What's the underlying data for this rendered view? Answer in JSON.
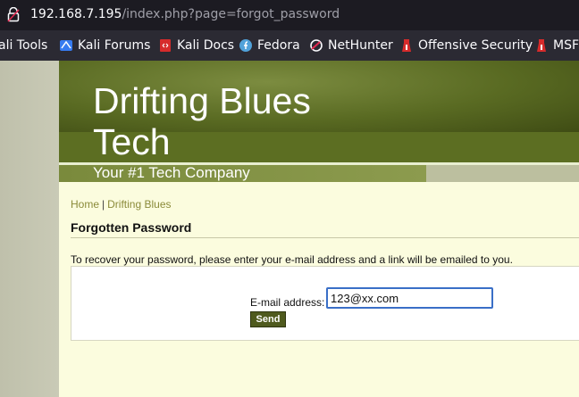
{
  "browser": {
    "url_host": "192.168.7.195",
    "url_path": "/index.php?page=forgot_password",
    "bookmarks": [
      {
        "label": "ali Tools",
        "icon": "kali-icon"
      },
      {
        "label": "Kali Forums",
        "icon": "kali-forums-icon"
      },
      {
        "label": "Kali Docs",
        "icon": "kali-docs-icon"
      },
      {
        "label": "Fedora",
        "icon": "fedora-icon"
      },
      {
        "label": "NetHunter",
        "icon": "nethunter-icon"
      },
      {
        "label": "Offensive Security",
        "icon": "offsec-icon"
      },
      {
        "label": "MSFU",
        "icon": "msfu-icon"
      }
    ]
  },
  "site": {
    "title": "Drifting Blues Tech",
    "tagline": "Your #1 Tech Company"
  },
  "breadcrumb": {
    "home": "Home",
    "separator": "|",
    "current": "Drifting Blues"
  },
  "page": {
    "heading": "Forgotten Password",
    "intro": "To recover your password, please enter your e-mail address and a link will be emailed to you."
  },
  "form": {
    "email_label": "E-mail address:",
    "email_value": "123@xx.com",
    "send_label": "Send"
  },
  "colors": {
    "header_green": "#5c6e22",
    "content_bg": "#fbfcde",
    "link_olive": "#8b8b3a",
    "button_bg": "#4f5a1e",
    "focus_blue": "#3a6fc7"
  }
}
